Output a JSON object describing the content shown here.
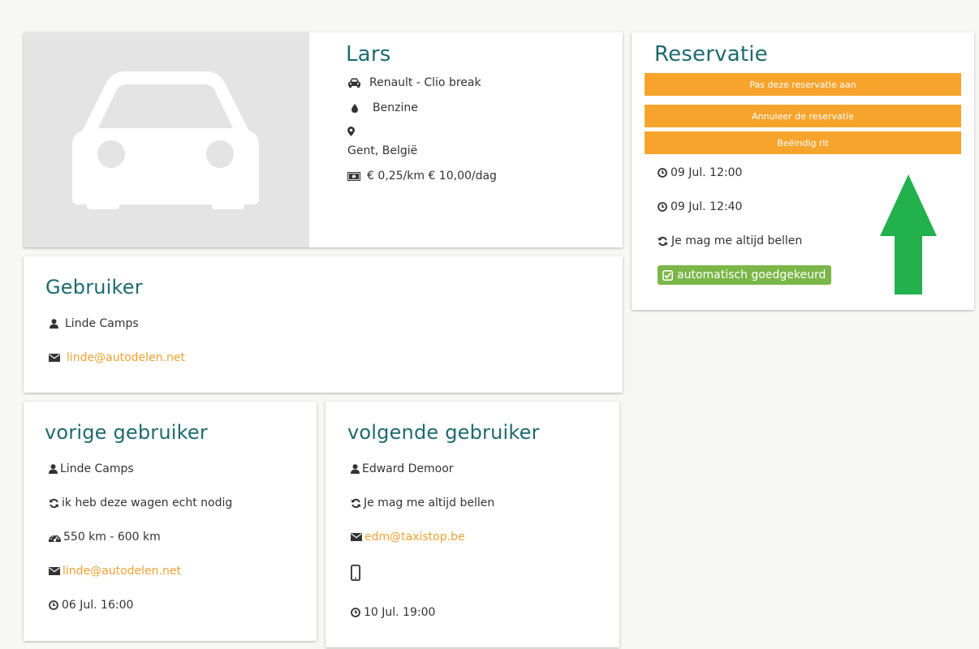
{
  "car": {
    "owner_name": "Lars",
    "model": "Renault - Clio break",
    "fuel": "Benzine",
    "location": "Gent, België",
    "price": "€ 0,25/km € 10,00/dag",
    "photo_icon": "car-placeholder-icon"
  },
  "reservation": {
    "title": "Reservatie",
    "edit_button": "Pas deze reservatie aan",
    "cancel_button": "Annuleer de reservatie",
    "end_button": "Beëindig rit",
    "start_time": "09 Jul. 12:00",
    "end_time": "09 Jul. 12:40",
    "note": "Je mag me altijd bellen",
    "status_badge": "automatisch goedgekeurd"
  },
  "user": {
    "title": "Gebruiker",
    "name": "Linde Camps",
    "email": "linde@autodelen.net"
  },
  "previous_user": {
    "title": "vorige gebruiker",
    "name": "Linde Camps",
    "note": "ik heb deze wagen echt nodig",
    "mileage": "550 km - 600 km",
    "email": "linde@autodelen.net",
    "time": "06 Jul. 16:00"
  },
  "next_user": {
    "title": "volgende gebruiker",
    "name": "Edward Demoor",
    "note": "Je mag me altijd bellen",
    "email": "edm@taxistop.be",
    "time": "10 Jul. 19:00"
  },
  "colors": {
    "accent_teal": "#1e6a6e",
    "button_orange": "#f7a42c",
    "link_orange": "#f0a032",
    "badge_green": "#7ab648",
    "arrow_green": "#22b14c"
  }
}
